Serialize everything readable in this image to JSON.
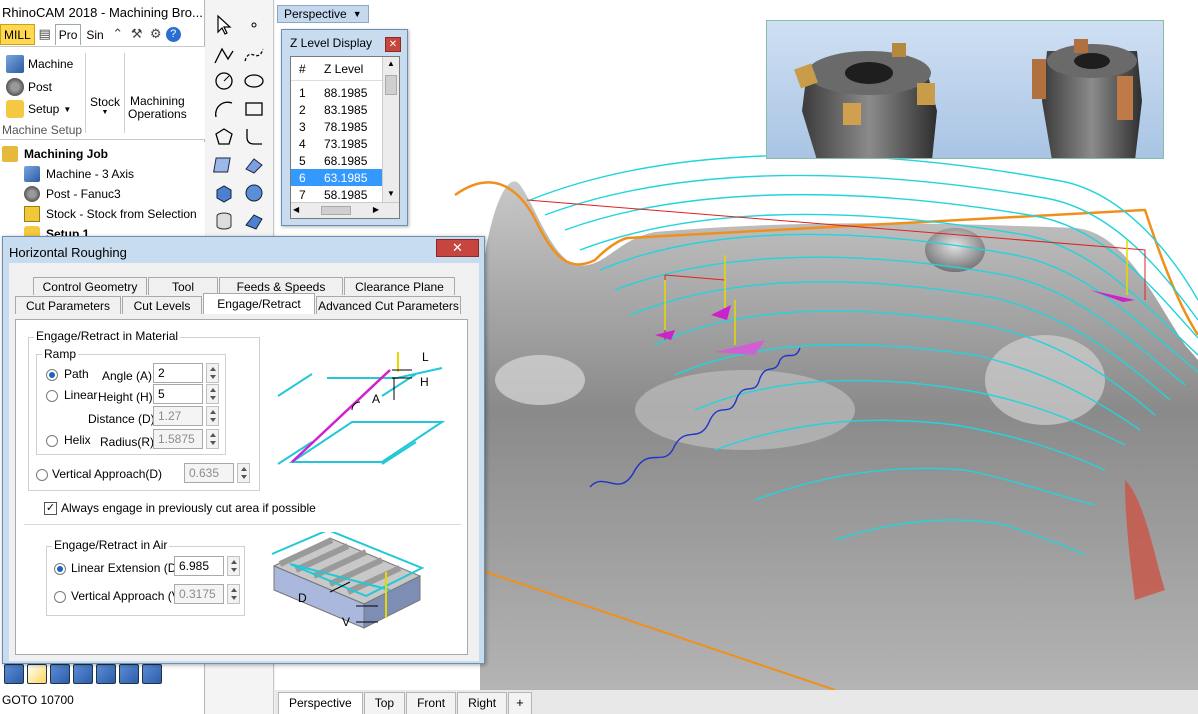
{
  "app": {
    "title": "RhinoCAM 2018 - Machining Bro...",
    "tabs": {
      "mill": "MILL",
      "pro": "Pro",
      "sim": "Sin"
    },
    "ribbon": {
      "machine": "Machine",
      "post": "Post",
      "setup": "Setup",
      "stock": "Stock",
      "machining_operations_1": "Machining",
      "machining_operations_2": "Operations",
      "group_label": "Machine Setup"
    },
    "tree": {
      "job": "Machining Job",
      "machine": "Machine - 3 Axis",
      "post": "Post - Fanuc3",
      "stock": "Stock - Stock from Selection",
      "setup": "Setup 1"
    },
    "status": "GOTO 10700"
  },
  "viewport": {
    "label": "Perspective",
    "tabs": [
      "Perspective",
      "Top",
      "Front",
      "Right"
    ],
    "add_tab": "+"
  },
  "zlevel": {
    "title": "Z Level Display",
    "col_num": "#",
    "col_z": "Z Level",
    "rows": [
      {
        "n": "1",
        "z": "88.1985"
      },
      {
        "n": "2",
        "z": "83.1985"
      },
      {
        "n": "3",
        "z": "78.1985"
      },
      {
        "n": "4",
        "z": "73.1985"
      },
      {
        "n": "5",
        "z": "68.1985"
      },
      {
        "n": "6",
        "z": "63.1985"
      },
      {
        "n": "7",
        "z": "58.1985"
      }
    ],
    "selected_row": "6"
  },
  "dialog": {
    "title": "Horizontal Roughing",
    "tabs_row1": [
      "Control Geometry",
      "Tool",
      "Feeds & Speeds",
      "Clearance Plane"
    ],
    "tabs_row2": [
      "Cut Parameters",
      "Cut Levels",
      "Engage/Retract",
      "Advanced Cut Parameters"
    ],
    "active_tab": "Engage/Retract",
    "material": {
      "group": "Engage/Retract in Material",
      "ramp": "Ramp",
      "path": "Path",
      "linear": "Linear",
      "helix": "Helix",
      "angle_label": "Angle (A)",
      "angle": "2",
      "height_label": "Height (H)",
      "height": "5",
      "distance_label": "Distance (D)",
      "distance": "1.27",
      "radius_label": "Radius(R)",
      "radius": "1.5875",
      "vertical_label": "Vertical Approach(D)",
      "vertical": "0.635",
      "always_engage": "Always engage in previously cut area if possible",
      "diagram_labels": {
        "l": "L",
        "h": "H",
        "a": "A"
      }
    },
    "air": {
      "group": "Engage/Retract in Air",
      "linear_label": "Linear Extension (D)",
      "linear": "6.985",
      "vertical_label": "Vertical Approach (V)",
      "vertical": "0.3175",
      "diagram_labels": {
        "d": "D",
        "v": "V"
      }
    }
  }
}
